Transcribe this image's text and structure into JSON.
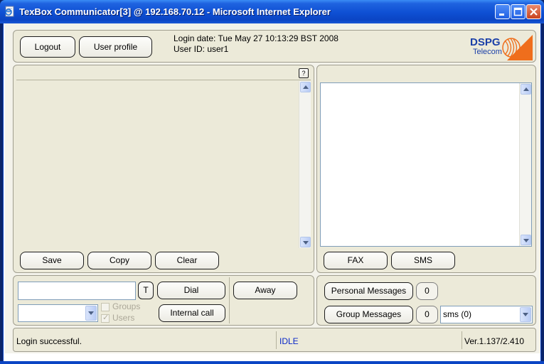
{
  "window": {
    "title": "TexBox Communicator[3] @ 192.168.70.12 - Microsoft Internet Explorer",
    "icons": {
      "app": "ie-page-icon",
      "minimize": "minimize-icon",
      "maximize": "maximize-icon",
      "close": "close-icon"
    }
  },
  "header": {
    "logout_label": "Logout",
    "user_profile_label": "User profile",
    "login_date": "Login date: Tue May 27 10:13:29 BST 2008",
    "user_id": "User ID: user1",
    "logo_line1": "DSPG",
    "logo_line2": "Telecom"
  },
  "left_panel": {
    "help_label": "?",
    "save_label": "Save",
    "copy_label": "Copy",
    "clear_label": "Clear"
  },
  "right_panel": {
    "fax_label": "FAX",
    "sms_label": "SMS"
  },
  "dial_panel": {
    "number_value": "",
    "t_label": "T",
    "dial_label": "Dial",
    "internal_call_label": "Internal call",
    "away_label": "Away",
    "contact_select_value": "",
    "groups_label": "Groups",
    "users_label": "Users"
  },
  "messages_panel": {
    "personal_label": "Personal Messages",
    "personal_count": "0",
    "group_label": "Group Messages",
    "group_count": "0",
    "sms_select_value": "sms (0)"
  },
  "statusbar": {
    "message": "Login successful.",
    "state": "IDLE",
    "version": "Ver.1.137/2.410"
  },
  "colors": {
    "titlebar": "#0b45c4",
    "panel_bg": "#ecead9",
    "status_state": "#0a28c8",
    "logo_blue": "#1a3fa8",
    "logo_orange": "#ef6e1c"
  }
}
